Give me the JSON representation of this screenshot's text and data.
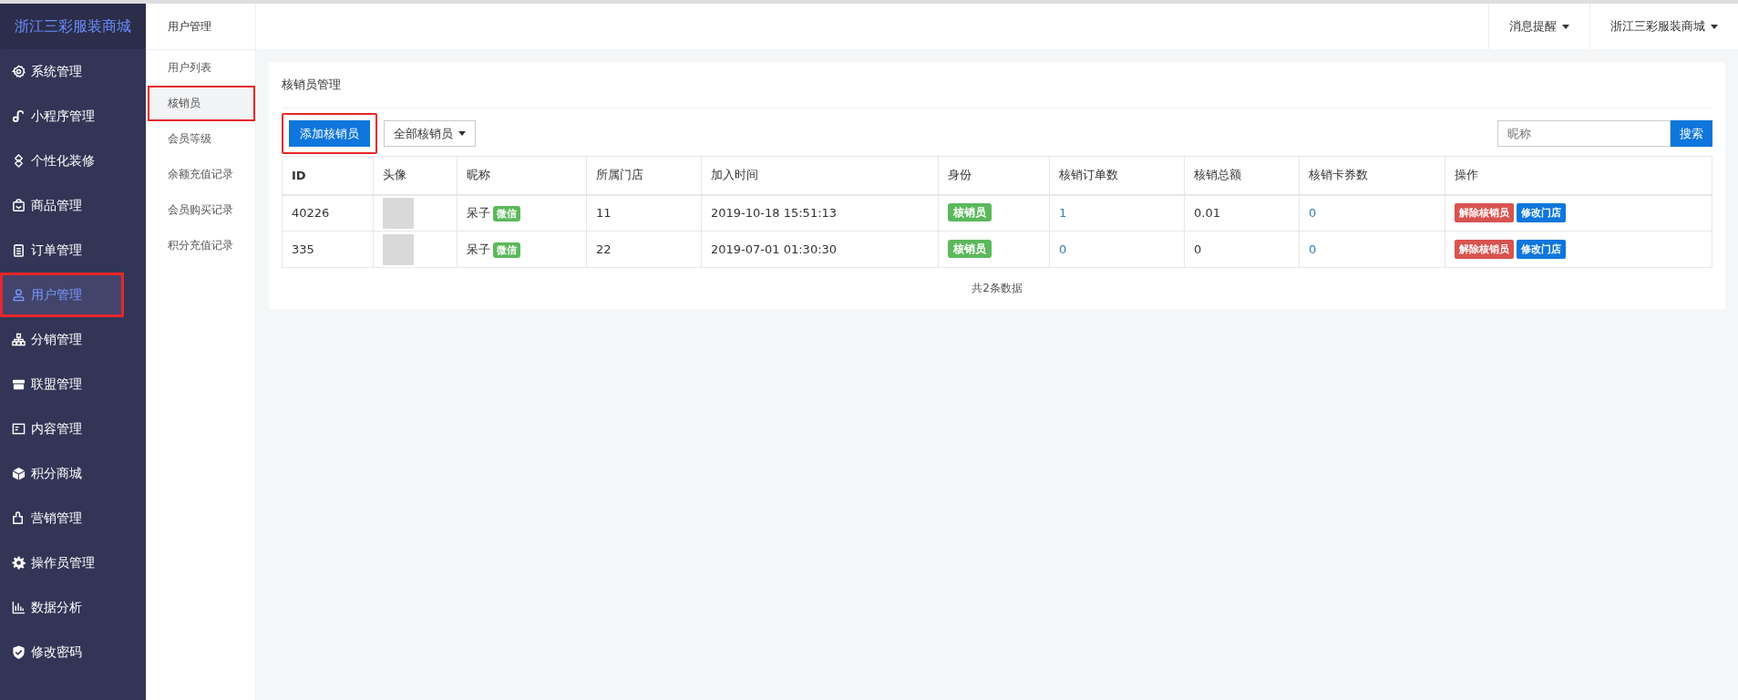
{
  "brand": "浙江三彩服装商城",
  "sidebar": {
    "items": [
      {
        "label": "系统管理",
        "selected": false,
        "annotated": false
      },
      {
        "label": "小程序管理",
        "selected": false,
        "annotated": false
      },
      {
        "label": "个性化装修",
        "selected": false,
        "annotated": false
      },
      {
        "label": "商品管理",
        "selected": false,
        "annotated": false
      },
      {
        "label": "订单管理",
        "selected": false,
        "annotated": false
      },
      {
        "label": "用户管理",
        "selected": true,
        "annotated": true
      },
      {
        "label": "分销管理",
        "selected": false,
        "annotated": false
      },
      {
        "label": "联盟管理",
        "selected": false,
        "annotated": false
      },
      {
        "label": "内容管理",
        "selected": false,
        "annotated": false
      },
      {
        "label": "积分商城",
        "selected": false,
        "annotated": false
      },
      {
        "label": "营销管理",
        "selected": false,
        "annotated": false
      },
      {
        "label": "操作员管理",
        "selected": false,
        "annotated": false
      },
      {
        "label": "数据分析",
        "selected": false,
        "annotated": false
      },
      {
        "label": "修改密码",
        "selected": false,
        "annotated": false
      }
    ]
  },
  "subnav": {
    "title": "用户管理",
    "items": [
      {
        "label": "用户列表",
        "selected": false,
        "annotated": false
      },
      {
        "label": "核销员",
        "selected": true,
        "annotated": true
      },
      {
        "label": "会员等级",
        "selected": false,
        "annotated": false
      },
      {
        "label": "余额充值记录",
        "selected": false,
        "annotated": false
      },
      {
        "label": "会员购买记录",
        "selected": false,
        "annotated": false
      },
      {
        "label": "积分充值记录",
        "selected": false,
        "annotated": false
      }
    ]
  },
  "header": {
    "menus": [
      "消息提醒",
      "浙江三彩服装商城"
    ]
  },
  "card": {
    "title": "核销员管理",
    "add_button": {
      "label": "添加核销员",
      "annotated": true
    },
    "filter": {
      "value": "全部核销员"
    },
    "search": {
      "placeholder": "昵称",
      "button": "搜索"
    },
    "table": {
      "columns": [
        "ID",
        "头像",
        "昵称",
        "所属门店",
        "加入时间",
        "身份",
        "核销订单数",
        "核销总额",
        "核销卡券数",
        "操作"
      ],
      "rows": [
        {
          "id": "40226",
          "nickname": "呆子",
          "source_tag": "微信",
          "store": "11",
          "joined": "2019-10-18 15:51:13",
          "role": "核销员",
          "orders": "1",
          "total": "0.01",
          "coupons": "0",
          "actions": [
            "解除核销员",
            "修改门店"
          ]
        },
        {
          "id": "335",
          "nickname": "呆子",
          "source_tag": "微信",
          "store": "22",
          "joined": "2019-07-01 01:30:30",
          "role": "核销员",
          "orders": "0",
          "total": "0",
          "coupons": "0",
          "actions": [
            "解除核销员",
            "修改门店"
          ]
        }
      ]
    },
    "footer": "共2条数据"
  }
}
